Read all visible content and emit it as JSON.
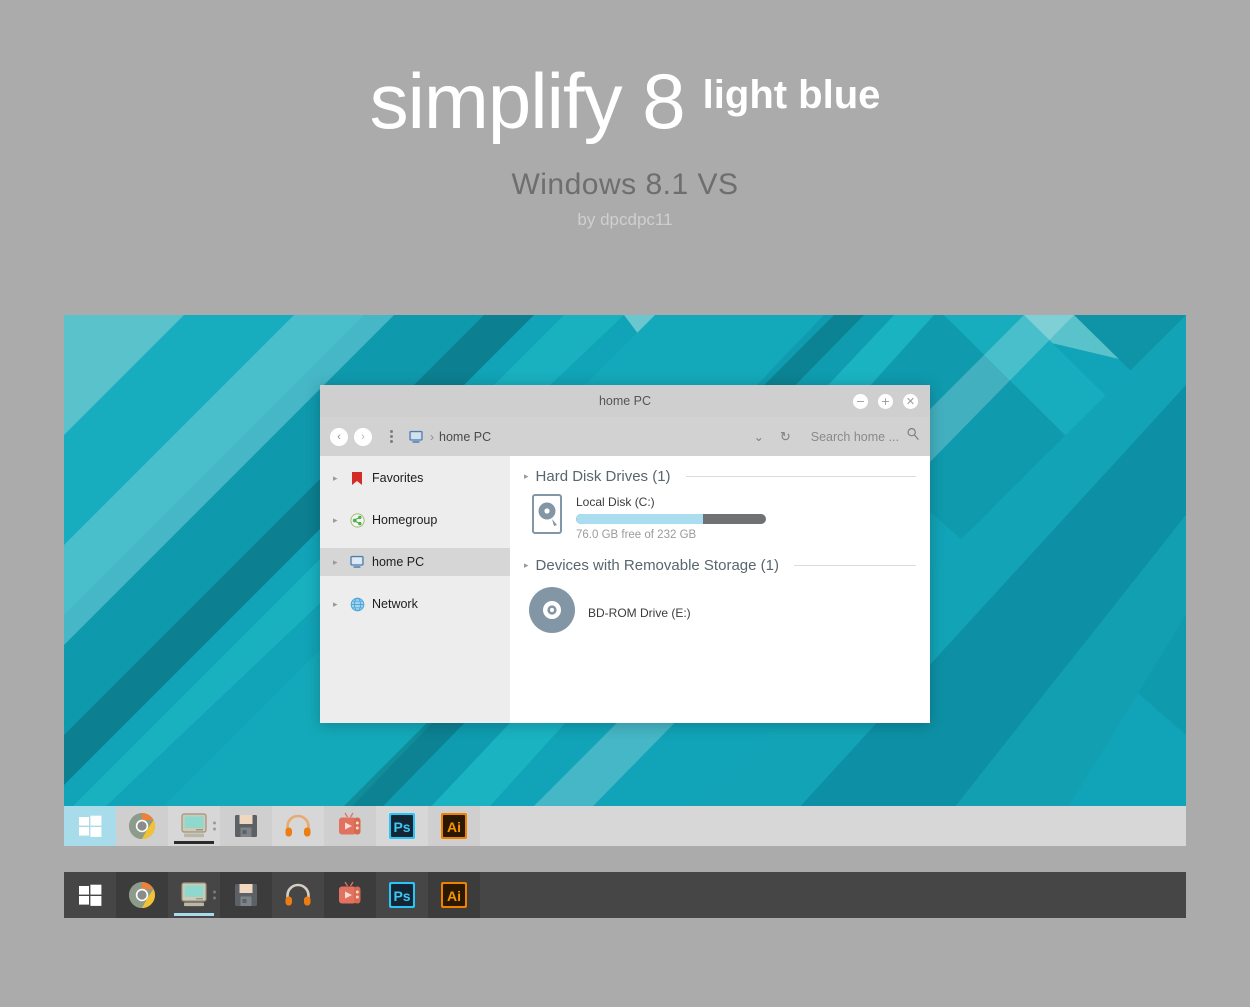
{
  "header": {
    "title_main": "simplify 8",
    "title_accent": "light blue",
    "subtitle": "Windows 8.1 VS",
    "byline": "by dpcdpc11"
  },
  "window": {
    "title": "home PC",
    "buttons": {
      "minimize": "−",
      "maximize": "+",
      "close": "✕"
    },
    "nav": {
      "back": "‹",
      "forward": "›",
      "menu_icon": "overflow-dots-icon",
      "breadcrumb_icon": "computer-icon",
      "breadcrumb_sep": "›",
      "breadcrumb_text": "home PC",
      "history_chevron": "⌄",
      "refresh": "↻",
      "search_placeholder": "Search home ...",
      "search_icon": "search-icon"
    },
    "sidebar": {
      "items": [
        {
          "label": "Favorites",
          "icon": "bookmark-icon",
          "active": false
        },
        {
          "label": "Homegroup",
          "icon": "share-icon",
          "active": false
        },
        {
          "label": "home PC",
          "icon": "computer-icon",
          "active": true
        },
        {
          "label": "Network",
          "icon": "globe-icon",
          "active": false
        }
      ],
      "expand_arrow": "▸"
    },
    "content": {
      "groups": [
        {
          "title": "Hard Disk Drives (1)",
          "items": [
            {
              "name": "Local Disk (C:)",
              "sub": "76.0 GB free of 232 GB",
              "icon": "hard-disk-icon",
              "used_percent": 67,
              "fill_color": "#aaddef",
              "track_color": "#6f7173"
            }
          ]
        },
        {
          "title": "Devices with Removable Storage (1)",
          "items": [
            {
              "name": "BD-ROM Drive (E:)",
              "sub": "",
              "icon": "optical-disc-icon"
            }
          ]
        }
      ]
    }
  },
  "desktop": {
    "wallpaper_colors": {
      "base": "#11a3b7",
      "band_light": "#1cb4c4",
      "band_lighter": "#3fbfca",
      "band_dark": "#0e95a8",
      "band_darker": "#0d8ba0",
      "top_pale": "#63c3cc"
    }
  },
  "taskbars": [
    {
      "variant": "light",
      "background": "#d7d7d7",
      "accent": "#a9dcea",
      "items": [
        {
          "name": "start-button",
          "icon": "windows-logo-icon",
          "state": "start",
          "dots": false
        },
        {
          "name": "taskbar-item-chrome",
          "icon": "chrome-icon",
          "state": "alt",
          "dots": false
        },
        {
          "name": "taskbar-item-explorer",
          "icon": "computer-icon",
          "state": "active",
          "dots": true
        },
        {
          "name": "taskbar-item-save",
          "icon": "floppy-disk-icon",
          "state": "alt",
          "dots": false
        },
        {
          "name": "taskbar-item-audio",
          "icon": "headphones-icon",
          "state": "normal",
          "dots": false
        },
        {
          "name": "taskbar-item-media",
          "icon": "tv-player-icon",
          "state": "alt",
          "dots": false
        },
        {
          "name": "taskbar-item-photoshop",
          "icon": "photoshop-icon",
          "state": "normal",
          "dots": false
        },
        {
          "name": "taskbar-item-illustrator",
          "icon": "illustrator-icon",
          "state": "alt",
          "dots": false
        }
      ]
    },
    {
      "variant": "dark",
      "background": "#464646",
      "accent": "#a9dcea",
      "items": [
        {
          "name": "start-button",
          "icon": "windows-logo-icon",
          "state": "start",
          "dots": false
        },
        {
          "name": "taskbar-item-chrome",
          "icon": "chrome-icon",
          "state": "alt",
          "dots": false
        },
        {
          "name": "taskbar-item-explorer",
          "icon": "computer-icon",
          "state": "active",
          "dots": true
        },
        {
          "name": "taskbar-item-save",
          "icon": "floppy-disk-icon",
          "state": "alt",
          "dots": false
        },
        {
          "name": "taskbar-item-audio",
          "icon": "headphones-icon",
          "state": "normal",
          "dots": false
        },
        {
          "name": "taskbar-item-media",
          "icon": "tv-player-icon",
          "state": "alt",
          "dots": false
        },
        {
          "name": "taskbar-item-photoshop",
          "icon": "photoshop-icon",
          "state": "normal",
          "dots": false
        },
        {
          "name": "taskbar-item-illustrator",
          "icon": "illustrator-icon",
          "state": "alt",
          "dots": false
        }
      ]
    }
  ]
}
